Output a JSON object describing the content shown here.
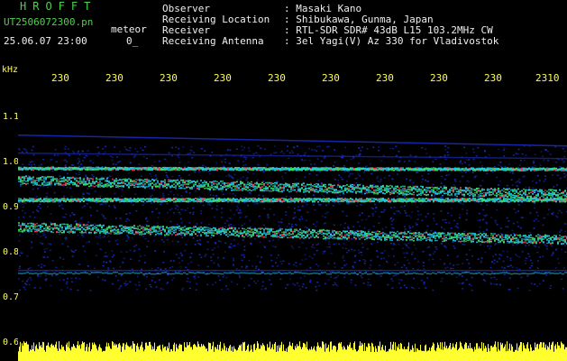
{
  "header": {
    "title": "HROFFT",
    "filename": "UT2506072300.pn",
    "filename_suffix": "meteor",
    "datetime": "25.06.07 23:00",
    "counter": "0_",
    "fields": [
      {
        "label": "Observer",
        "value": ": Masaki Kano"
      },
      {
        "label": "Receiving Location",
        "value": ": Shibukawa, Gunma, Japan"
      },
      {
        "label": "Receiver",
        "value": ": RTL-SDR SDR# 43dB L15 103.2MHz CW"
      },
      {
        "label": "Receiving Antenna",
        "value": ": 3el Yagi(V) Az 330 for Vladivostok"
      }
    ]
  },
  "axes": {
    "y_unit": "kHz",
    "y_labels": [
      "1.1",
      "1.0",
      "0.9",
      "0.8",
      "0.7",
      "0.6"
    ],
    "x_labels": [
      "230",
      "230",
      "230",
      "230",
      "230",
      "230",
      "230",
      "230",
      "230",
      "2310"
    ]
  },
  "colors": {
    "background": "#000000",
    "noise_blue": "#1a30d0",
    "signal_cyan": "#20c8e0",
    "signal_green": "#40e060",
    "signal_red": "#ff3050",
    "amplitude_yellow": "#ffff30"
  }
}
